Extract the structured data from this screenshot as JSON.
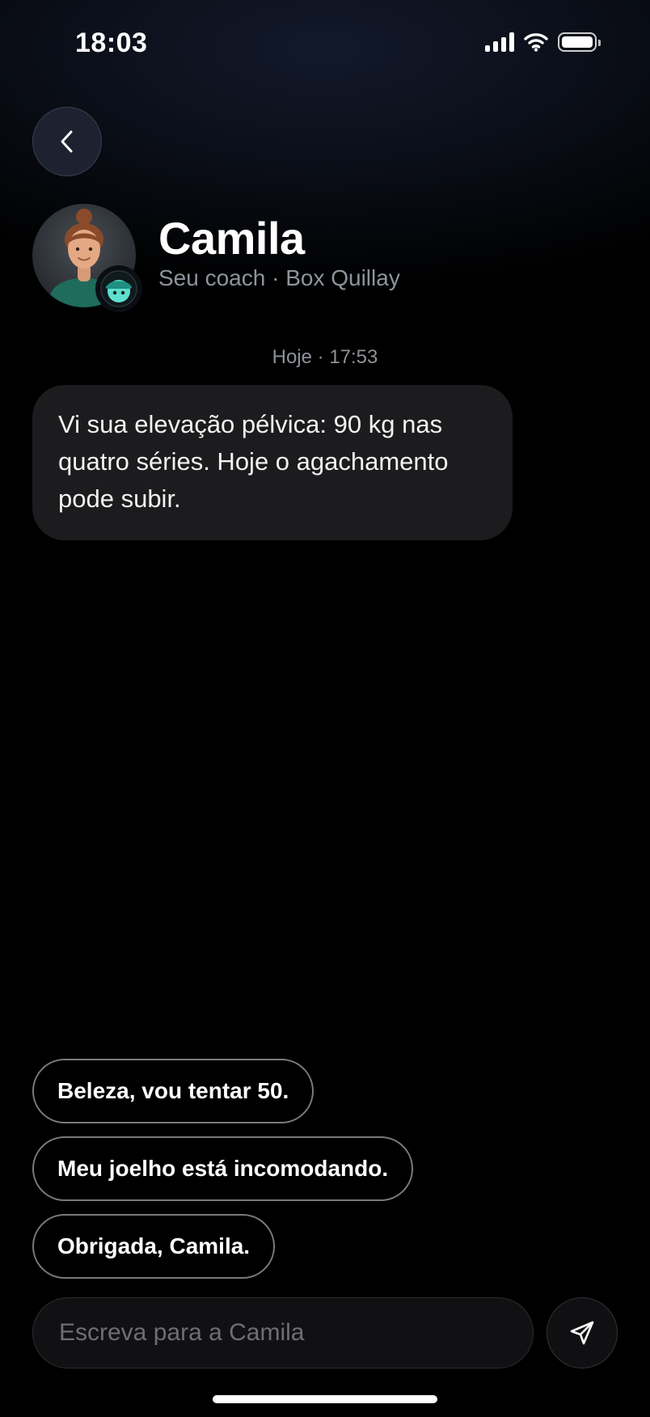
{
  "status_bar": {
    "time": "18:03",
    "signal_icon": "cellular-signal-icon",
    "wifi_icon": "wifi-icon",
    "battery_icon": "battery-icon"
  },
  "header": {
    "back_icon": "chevron-left-icon",
    "name": "Camila",
    "subtitle": "Seu coach · Box Quillay",
    "badge_icon": "coach-badge-icon"
  },
  "conversation": {
    "timestamp": "Hoje · 17:53",
    "messages": [
      {
        "sender": "Camila",
        "text": "Vi sua elevação pélvica: 90 kg nas quatro séries. Hoje o agachamento pode subir."
      }
    ]
  },
  "quick_replies": [
    {
      "label": "Beleza, vou tentar 50."
    },
    {
      "label": "Meu joelho está incomodando."
    },
    {
      "label": "Obrigada, Camila."
    }
  ],
  "composer": {
    "placeholder": "Escreva para a Camila",
    "value": "",
    "send_icon": "send-icon"
  },
  "colors": {
    "background": "#000000",
    "bubble": "#1c1c1e",
    "badge": "#5fe0cf"
  }
}
